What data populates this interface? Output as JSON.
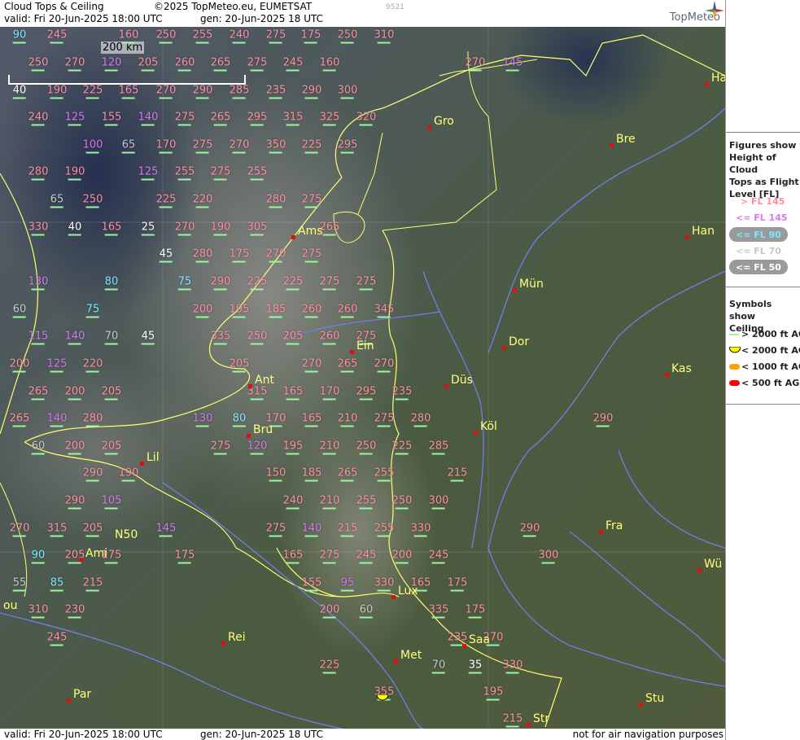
{
  "header": {
    "title": "Cloud Tops & Ceiling",
    "copyright": "©2025 TopMeteo.eu, EUMETSAT",
    "valid": "valid:  Fri  20-Jun-2025  18:00 UTC",
    "gen": "gen: 20-Jun-2025 18 UTC",
    "code": "9521",
    "brand": "TopMeteo"
  },
  "footer": {
    "valid": "valid:  Fri  20-Jun-2025  18:00 UTC",
    "gen": "gen: 20-Jun-2025 18 UTC",
    "note": "not for air navigation purposes"
  },
  "scale_label": "200 km",
  "legend": {
    "title": [
      "Figures show",
      "Height of Cloud",
      "Tops as Flight",
      "Level  [FL]"
    ],
    "fl_items": [
      {
        "label": "> FL 145",
        "color": "#ff8fa0"
      },
      {
        "label": "<= FL 145",
        "color": "#d878f0"
      },
      {
        "label": "<= FL 90",
        "color": "#7be8ff"
      },
      {
        "label": "<= FL 70",
        "color": "#c8c8c8"
      },
      {
        "label": "<= FL 50",
        "color": "#ffffff"
      }
    ],
    "sym_title": [
      "Symbols show",
      "Ceiling"
    ],
    "sym_items": [
      {
        "label": "> 2000 ft AGL",
        "color": "#9ef59e",
        "shape": "line"
      },
      {
        "label": "< 2000 ft AGL",
        "color": "#ffff00",
        "shape": "half-circle"
      },
      {
        "label": "< 1000 ft AGL",
        "color": "#ffa000",
        "shape": "pill"
      },
      {
        "label": "< 500 ft AGL",
        "color": "#ff0000",
        "shape": "pill"
      }
    ]
  },
  "cities": [
    {
      "name": "Gro"
    },
    {
      "name": "Bre"
    },
    {
      "name": "Ha"
    },
    {
      "name": "Ams"
    },
    {
      "name": "Han"
    },
    {
      "name": "Mün"
    },
    {
      "name": "Dor"
    },
    {
      "name": "Ein"
    },
    {
      "name": "Düs"
    },
    {
      "name": "Kas"
    },
    {
      "name": "Ant"
    },
    {
      "name": "Köl"
    },
    {
      "name": "Bru"
    },
    {
      "name": "Lil"
    },
    {
      "name": "Fra"
    },
    {
      "name": "Ami"
    },
    {
      "name": "N50"
    },
    {
      "name": "Wü"
    },
    {
      "name": "Lux"
    },
    {
      "name": "Saa"
    },
    {
      "name": "Rei"
    },
    {
      "name": "Met"
    },
    {
      "name": "Par"
    },
    {
      "name": "Stu"
    },
    {
      "name": "Str"
    },
    {
      "name": "ou"
    }
  ],
  "flight_levels": [
    "90",
    "245",
    "160",
    "250",
    "255",
    "240",
    "275",
    "175",
    "250",
    "310",
    "250",
    "270",
    "120",
    "205",
    "260",
    "265",
    "275",
    "245",
    "160",
    "270",
    "145",
    "40",
    "190",
    "225",
    "165",
    "270",
    "290",
    "285",
    "235",
    "290",
    "300",
    "240",
    "125",
    "155",
    "140",
    "275",
    "265",
    "295",
    "315",
    "325",
    "320",
    "100",
    "65",
    "170",
    "275",
    "270",
    "350",
    "225",
    "295",
    "280",
    "190",
    "125",
    "255",
    "275",
    "255",
    "65",
    "250",
    "225",
    "220",
    "280",
    "275",
    "330",
    "40",
    "165",
    "25",
    "270",
    "190",
    "305",
    "265",
    "45",
    "280",
    "175",
    "270",
    "275",
    "130",
    "80",
    "75",
    "290",
    "225",
    "225",
    "275",
    "275",
    "60",
    "75",
    "200",
    "195",
    "185",
    "260",
    "260",
    "345",
    "115",
    "140",
    "70",
    "45",
    "335",
    "250",
    "205",
    "260",
    "275",
    "200",
    "125",
    "220",
    "205",
    "270",
    "265",
    "270",
    "265",
    "200",
    "205",
    "315",
    "165",
    "170",
    "295",
    "235",
    "265",
    "140",
    "280",
    "130",
    "80",
    "170",
    "165",
    "210",
    "275",
    "280",
    "290",
    "60",
    "200",
    "205",
    "275",
    "120",
    "195",
    "210",
    "250",
    "225",
    "285",
    "290",
    "190",
    "150",
    "185",
    "265",
    "255",
    "215",
    "290",
    "105",
    "240",
    "210",
    "255",
    "250",
    "300",
    "270",
    "315",
    "205",
    "145",
    "275",
    "140",
    "215",
    "255",
    "330",
    "290",
    "90",
    "205",
    "175",
    "175",
    "165",
    "275",
    "245",
    "200",
    "245",
    "300",
    "55",
    "85",
    "215",
    "155",
    "95",
    "330",
    "165",
    "175",
    "310",
    "230",
    "200",
    "60",
    "335",
    "175",
    "245",
    "235",
    "270",
    "225",
    "70",
    "35",
    "330",
    "355",
    "195",
    "215",
    "210"
  ]
}
